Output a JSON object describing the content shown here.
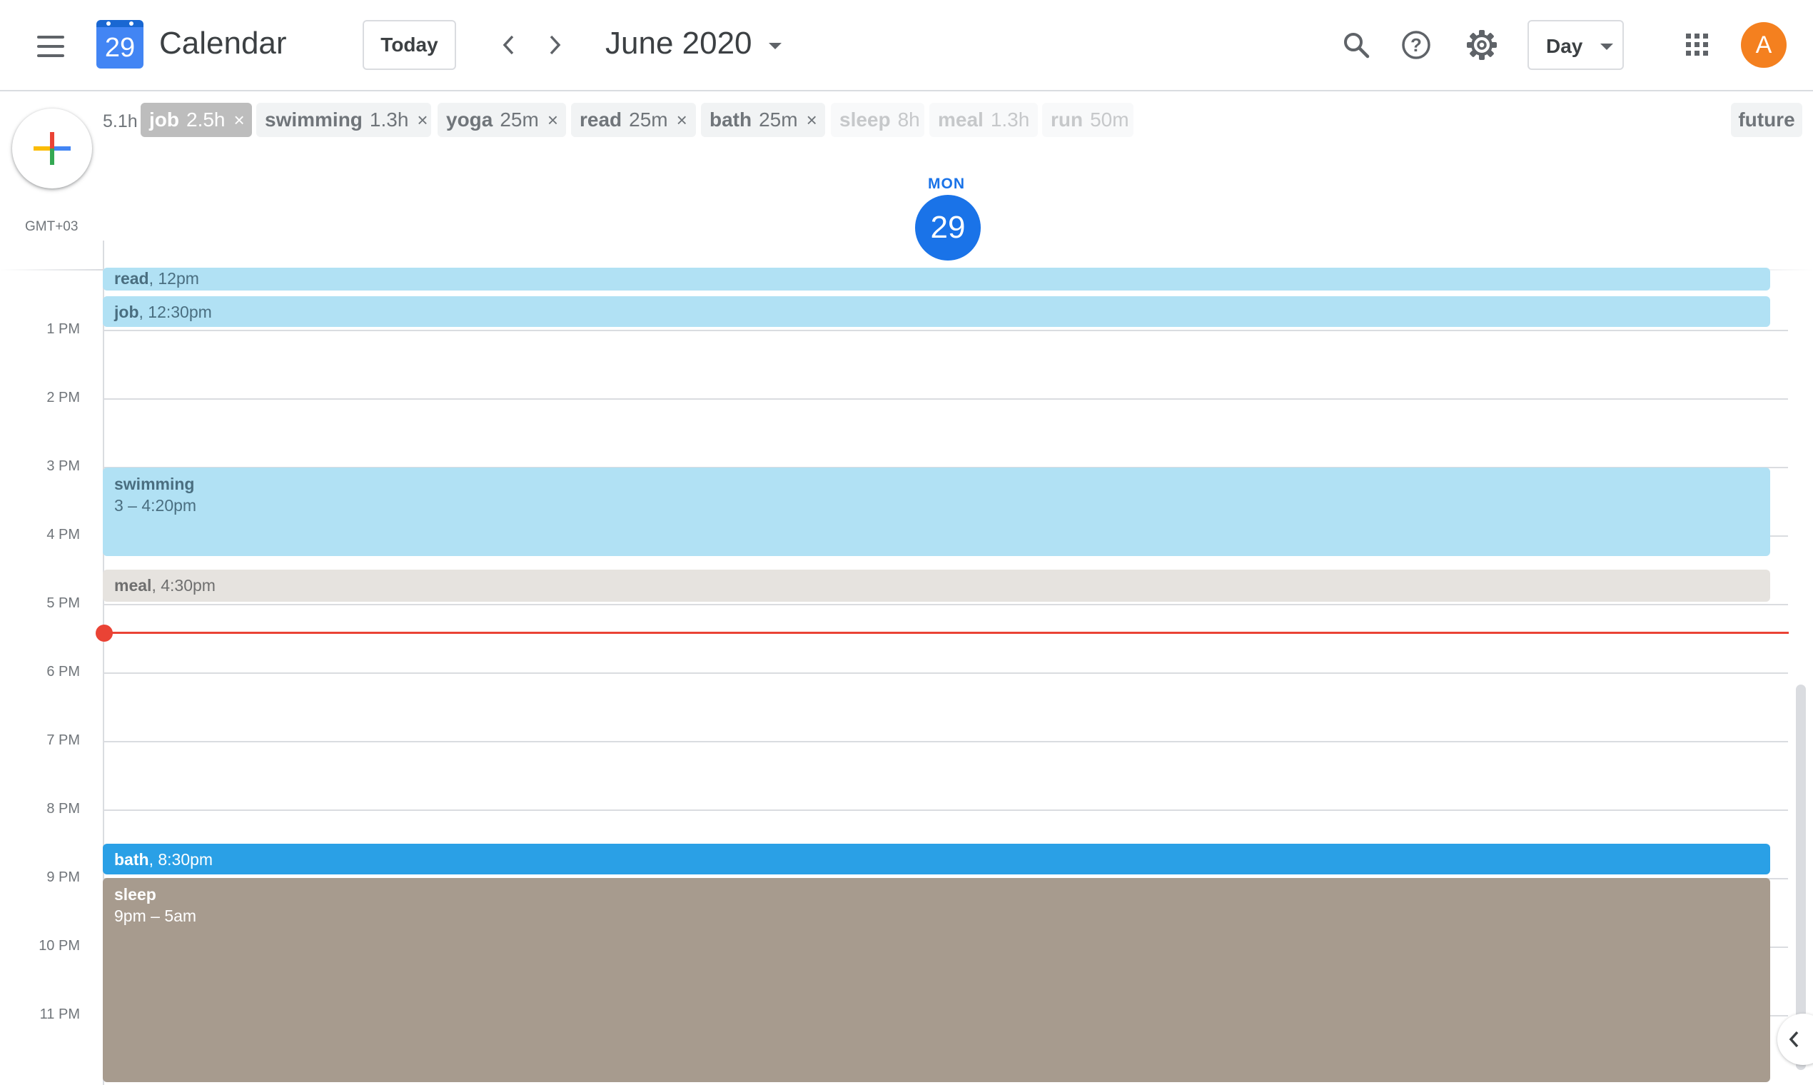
{
  "header": {
    "app_title": "Calendar",
    "logo_day": "29",
    "today_label": "Today",
    "month_label": "June 2020",
    "view_label": "Day",
    "avatar_letter": "A"
  },
  "filters": {
    "total": "5.1h",
    "chips": [
      {
        "name": "job",
        "duration": "2.5h",
        "state": "active-selected",
        "close": "×"
      },
      {
        "name": "swimming",
        "duration": "1.3h",
        "state": "active",
        "close": "×"
      },
      {
        "name": "yoga",
        "duration": "25m",
        "state": "active",
        "close": "×"
      },
      {
        "name": "read",
        "duration": "25m",
        "state": "active",
        "close": "×"
      },
      {
        "name": "bath",
        "duration": "25m",
        "state": "active",
        "close": "×"
      },
      {
        "name": "sleep",
        "duration": "8h",
        "state": "inactive"
      },
      {
        "name": "meal",
        "duration": "1.3h",
        "state": "inactive"
      },
      {
        "name": "run",
        "duration": "50m",
        "state": "inactive"
      }
    ],
    "future_label": "future"
  },
  "day_header": {
    "timezone": "GMT+03",
    "weekday": "MON",
    "day_number": "29"
  },
  "hours": [
    "1 PM",
    "2 PM",
    "3 PM",
    "4 PM",
    "5 PM",
    "6 PM",
    "7 PM",
    "8 PM",
    "9 PM",
    "10 PM",
    "11 PM"
  ],
  "events": [
    {
      "name": "read",
      "time": ", 12pm"
    },
    {
      "name": "job",
      "time": ", 12:30pm"
    },
    {
      "name": "swimming",
      "time": "3 – 4:20pm"
    },
    {
      "name": "meal",
      "time": ", 4:30pm"
    },
    {
      "name": "bath",
      "time": ", 8:30pm"
    },
    {
      "name": "sleep",
      "time": "9pm – 5am"
    }
  ],
  "colors": {
    "accent": "#1a73e8",
    "now_indicator": "#ea4335",
    "avatar": "#f4801f",
    "event_light_blue": "#b1e1f4",
    "event_blue": "#2aa0e6",
    "event_grey": "#e6e3df",
    "event_taupe": "#a79b8e"
  },
  "icons": [
    "menu-icon",
    "calendar-logo-icon",
    "chevron-left-icon",
    "chevron-right-icon",
    "caret-down-icon",
    "search-icon",
    "help-icon",
    "settings-gear-icon",
    "apps-grid-icon",
    "plus-icon",
    "close-icon",
    "chevron-left-collapse-icon"
  ]
}
